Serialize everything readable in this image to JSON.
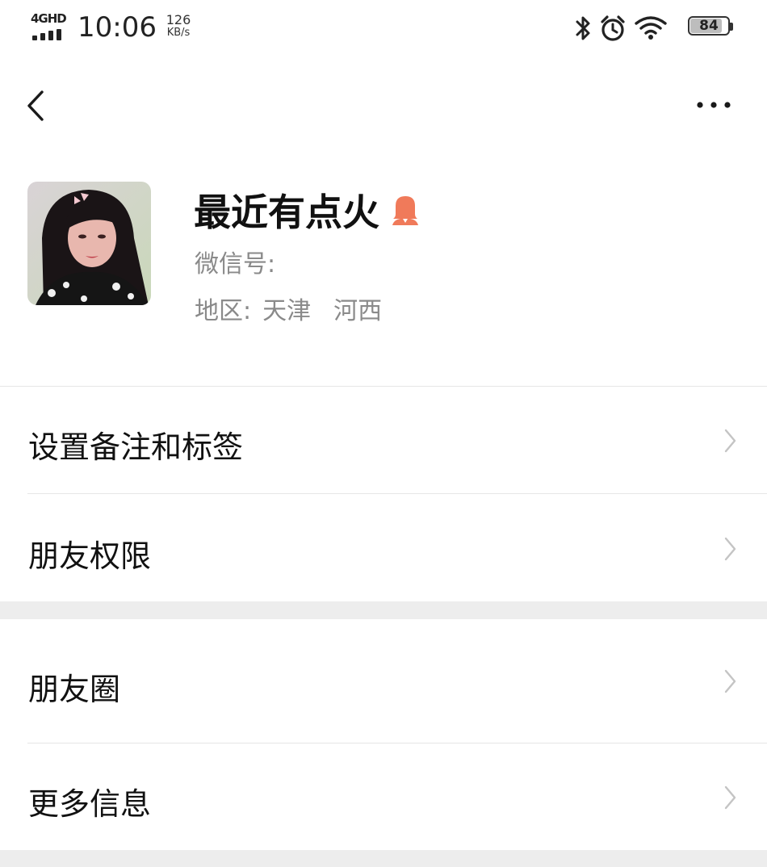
{
  "status_bar": {
    "network": "4GHD",
    "time": "10:06",
    "speed_value": "126",
    "speed_unit": "KB/s",
    "icons": [
      "bluetooth-icon",
      "alarm-icon",
      "wifi-icon"
    ],
    "battery": "84",
    "battery_fraction": 0.84
  },
  "nav": {
    "back_icon": "chevron-left-icon",
    "more_icon": "more-horizontal-icon"
  },
  "profile": {
    "name": "最近有点火",
    "gender_icon": "female-user-icon",
    "wechat_id_label": "微信号:",
    "region_label": "地区:",
    "region_city": "天津",
    "region_district": "河西"
  },
  "menu": {
    "section1": [
      {
        "label": "设置备注和标签"
      },
      {
        "label": "朋友权限"
      }
    ],
    "section2": [
      {
        "label": "朋友圈"
      },
      {
        "label": "更多信息"
      }
    ]
  },
  "colors": {
    "background": "#ffffff",
    "section_gap": "#ededed",
    "divider": "#e6e6e6",
    "secondary_text": "#8a8a8a",
    "chevron": "#c4c4c4",
    "gender_icon": "#f07a5a"
  }
}
